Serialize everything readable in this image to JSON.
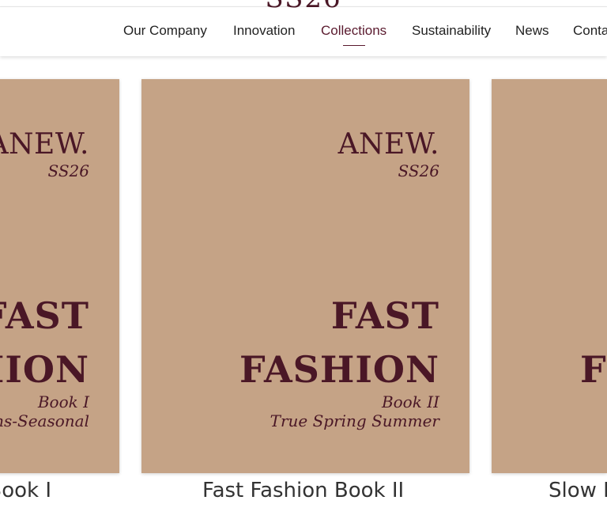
{
  "logo_partial": "SS26",
  "nav": {
    "items": [
      {
        "label": "Our Company"
      },
      {
        "label": "Innovation"
      },
      {
        "label": "Collections"
      },
      {
        "label": "Sustainability"
      },
      {
        "label": "News"
      },
      {
        "label": "Conta"
      }
    ],
    "active_index": 2
  },
  "cards": [
    {
      "brand": "ANEW.",
      "season": "SS26",
      "title_line1": "FAST",
      "title_line2": "FASHION",
      "book": "Book I",
      "subtitle": "Trans-Seasonal",
      "caption": "Fast Fashion Book I"
    },
    {
      "brand": "ANEW.",
      "season": "SS26",
      "title_line1": "FAST",
      "title_line2": "FASHION",
      "book": "Book II",
      "subtitle": "True Spring Summer",
      "caption": "Fast Fashion Book II"
    },
    {
      "title_partial": "F",
      "caption": "Slow F"
    }
  ],
  "colors": {
    "card_bg": "#c5a386",
    "brand_text": "#4a1726",
    "nav_active": "#5a1a2e"
  }
}
